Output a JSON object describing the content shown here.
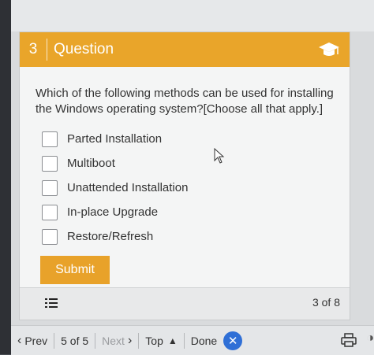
{
  "question": {
    "number": "3",
    "header_title": "Question",
    "text": "Which of the following methods can be used for installing the Windows operating system?[Choose all that apply.]",
    "options": [
      {
        "label": "Parted Installation",
        "checked": false
      },
      {
        "label": "Multiboot",
        "checked": false
      },
      {
        "label": "Unattended Installation",
        "checked": false
      },
      {
        "label": "In-place Upgrade",
        "checked": false
      },
      {
        "label": "Restore/Refresh",
        "checked": false
      }
    ],
    "submit_label": "Submit",
    "page_count": "3 of 8",
    "header_color": "#e9a52a",
    "icon": "graduation-cap-icon"
  },
  "nav": {
    "prev_label": "Prev",
    "position": "5 of 5",
    "next_label": "Next",
    "top_label": "Top",
    "done_label": "Done"
  }
}
